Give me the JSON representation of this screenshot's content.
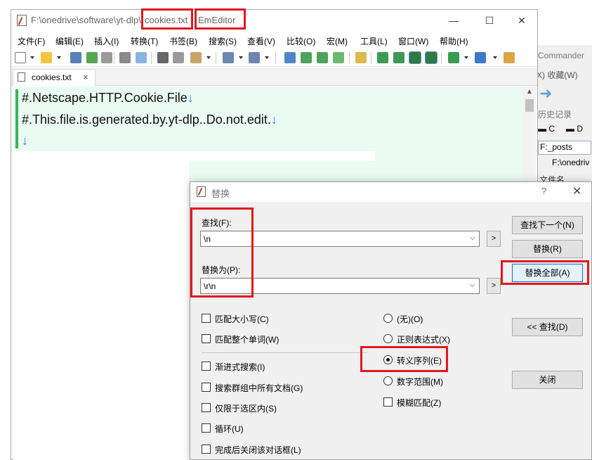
{
  "background_window": {
    "title": "Commander",
    "menu": "X)  收藏(W)",
    "history": "历史记录",
    "drive_c": "C",
    "drive_d": "D",
    "path_box": "F:_posts",
    "path2": "F:\\onedriv",
    "filename_header": "文件名"
  },
  "window": {
    "path": "F:\\onedrive\\software\\yt-dlp\\",
    "filename": "cookies.txt",
    "app_name": "EmEditor",
    "minimize": "—",
    "maximize": "☐",
    "close": "✕"
  },
  "menu": {
    "items": [
      "文件(F)",
      "编辑(E)",
      "插入(I)",
      "转换(T)",
      "书签(B)",
      "搜索(S)",
      "查看(V)",
      "比较(O)",
      "宏(M)",
      "工具(L)",
      "窗口(W)",
      "帮助(H)"
    ]
  },
  "tab": {
    "label": "cookies.txt",
    "close": "×"
  },
  "editor": {
    "line1": "#.Netscape.HTTP.Cookie.File",
    "line2": "#.This.file.is.generated.by.yt-dlp..Do.not.edit.",
    "newline_mark": "↓"
  },
  "dialog": {
    "title": "替换",
    "help": "?",
    "close": "✕",
    "find_label": "查找(F):",
    "find_value": "\\n",
    "replace_label": "替换为(P):",
    "replace_value": "\\r\\n",
    "combo_arrow": "⌵",
    "side_button": ">",
    "buttons": {
      "find_next": "查找下一个(N)",
      "replace": "替换(R)",
      "replace_all": "替换全部(A)",
      "find_collapse": "<< 查找(D)",
      "close": "关闭"
    },
    "checkboxes": {
      "match_case": "匹配大小写(C)",
      "whole_word": "匹配整个单词(W)",
      "incremental": "渐进式搜索(I)",
      "search_all_docs": "搜索群组中所有文档(G)",
      "selection_only": "仅限于选区内(S)",
      "loop": "循环(U)",
      "close_when_done": "完成后关闭该对话框(L)"
    },
    "radios": {
      "none": "(无)(O)",
      "regex": "正则表达式(X)",
      "escape": "转义序列(E)",
      "numeric_range": "数字范围(M)"
    },
    "fuzzy": "模糊匹配(Z)",
    "selected_mode": "escape"
  },
  "colors": {
    "highlight_red": "#e0191e",
    "editor_green": "#eafbf1",
    "newline_blue": "#2d7ad6"
  }
}
